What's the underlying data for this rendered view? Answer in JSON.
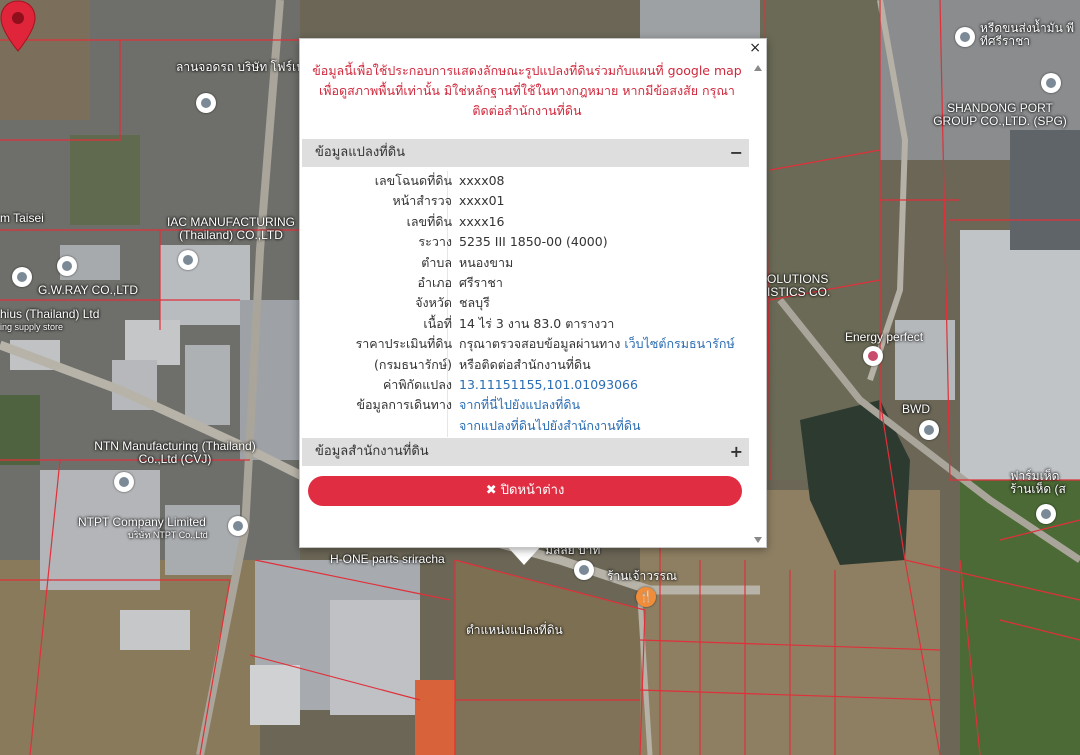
{
  "map": {
    "pois": [
      {
        "name": "ลานจอดรถ บริษัท โฟร์เฟรนด์ เทรเวล...",
        "kind": "place"
      },
      {
        "name": "m Taisei",
        "kind": "place"
      },
      {
        "name": "IAC MANUFACTURING (Thailand) CO.,LTD",
        "kind": "place"
      },
      {
        "name": "G.W.RAY CO.,LTD",
        "kind": "place"
      },
      {
        "name": "hius (Thailand) Ltd",
        "kind": "place"
      },
      {
        "name": "ing supply store",
        "kind": "place"
      },
      {
        "name": "NTN Manufacturing (Thailand) Co.,Ltd (CVJ)",
        "kind": "place"
      },
      {
        "name": "NTPT Company Limited",
        "kind": "place"
      },
      {
        "name": "บริษัท NTPT Co.,Ltd",
        "kind": "place"
      },
      {
        "name": "H-ONE parts sriracha",
        "kind": "place"
      },
      {
        "name": "ร้านเจ้าวรรณ",
        "kind": "food"
      },
      {
        "name": "มัลลัย บาท",
        "kind": "place"
      },
      {
        "name": "หรีดขนส่งน้ำมัน พีทีศรีราชา",
        "kind": "place"
      },
      {
        "name": "SHANDONG PORT GROUP CO.,LTD. (SPG)",
        "kind": "place"
      },
      {
        "name": "OLUTIONS ISTICS CO.",
        "kind": "place"
      },
      {
        "name": "Energy perfect",
        "kind": "shop"
      },
      {
        "name": "BWD",
        "kind": "place"
      },
      {
        "name": "ฟาร์มเห็ด ร้านเห็ด (ส",
        "kind": "place"
      }
    ],
    "marker_label": "ตำแหน่งแปลงที่ดิน",
    "marker_color": "#e0253b",
    "parcel_line_color": "#e0303a"
  },
  "popup": {
    "close_symbol": "×",
    "disclaimer": "ข้อมูลนี้เพื่อใช้ประกอบการแสดงลักษณะรูปแปลงที่ดินร่วมกับแผนที่ google map เพื่อดูสภาพพื้นที่เท่านั้น มิใช่หลักฐานที่ใช้ในทางกฎหมาย หากมีข้อสงสัย กรุณาติดต่อสำนักงานที่ดิน",
    "disclaimer_lines": [
      "ข้อมูลนี้เพื่อใช้ประกอบการแสดงลักษณะรูปแปลงที่ดินร่วมกับแผนที่ google map",
      "เพื่อดูสภาพพื้นที่เท่านั้น มิใช่หลักฐานที่ใช้ในทางกฎหมาย หากมีข้อสงสัย กรุณา",
      "ติดต่อสำนักงานที่ดิน"
    ],
    "parcel_section": {
      "title": "ข้อมูลแปลงที่ดิน",
      "toggle": "−"
    },
    "rows": [
      {
        "label": "เลขโฉนดที่ดิน",
        "value": "xxxx08"
      },
      {
        "label": "หน้าสำรวจ",
        "value": "xxxx01"
      },
      {
        "label": "เลขที่ดิน",
        "value": "xxxx16"
      },
      {
        "label": "ระวาง",
        "value": "5235 III 1850-00 (4000)"
      },
      {
        "label": "ตำบล",
        "value": "หนองขาม"
      },
      {
        "label": "อำเภอ",
        "value": "ศรีราชา"
      },
      {
        "label": "จังหวัด",
        "value": "ชลบุรี"
      },
      {
        "label": "เนื้อที่",
        "value": "14 ไร่ 3 งาน 83.0 ตารางวา"
      }
    ],
    "appraisal": {
      "label_1": "ราคาประเมินที่ดิน",
      "label_2": "(กรมธนารักษ์)",
      "value_text": "กรุณาตรวจสอบข้อมูลผ่านทาง",
      "value_link": "เว็บไซต์กรมธนารักษ์",
      "value_line2": "หรือติดต่อสำนักงานที่ดิน"
    },
    "coords": {
      "label": "ค่าพิกัดแปลง",
      "value": "13.11151155,101.01093066"
    },
    "travel": {
      "label": "ข้อมูลการเดินทาง",
      "link_1": "จากที่นี่ไปยังแปลงที่ดิน",
      "link_2": "จากแปลงที่ดินไปยังสำนักงานที่ดิน"
    },
    "office_section": {
      "title": "ข้อมูลสำนักงานที่ดิน",
      "toggle": "+"
    },
    "close_button": {
      "icon": "✖",
      "label": "ปิดหน้าต่าง"
    }
  }
}
